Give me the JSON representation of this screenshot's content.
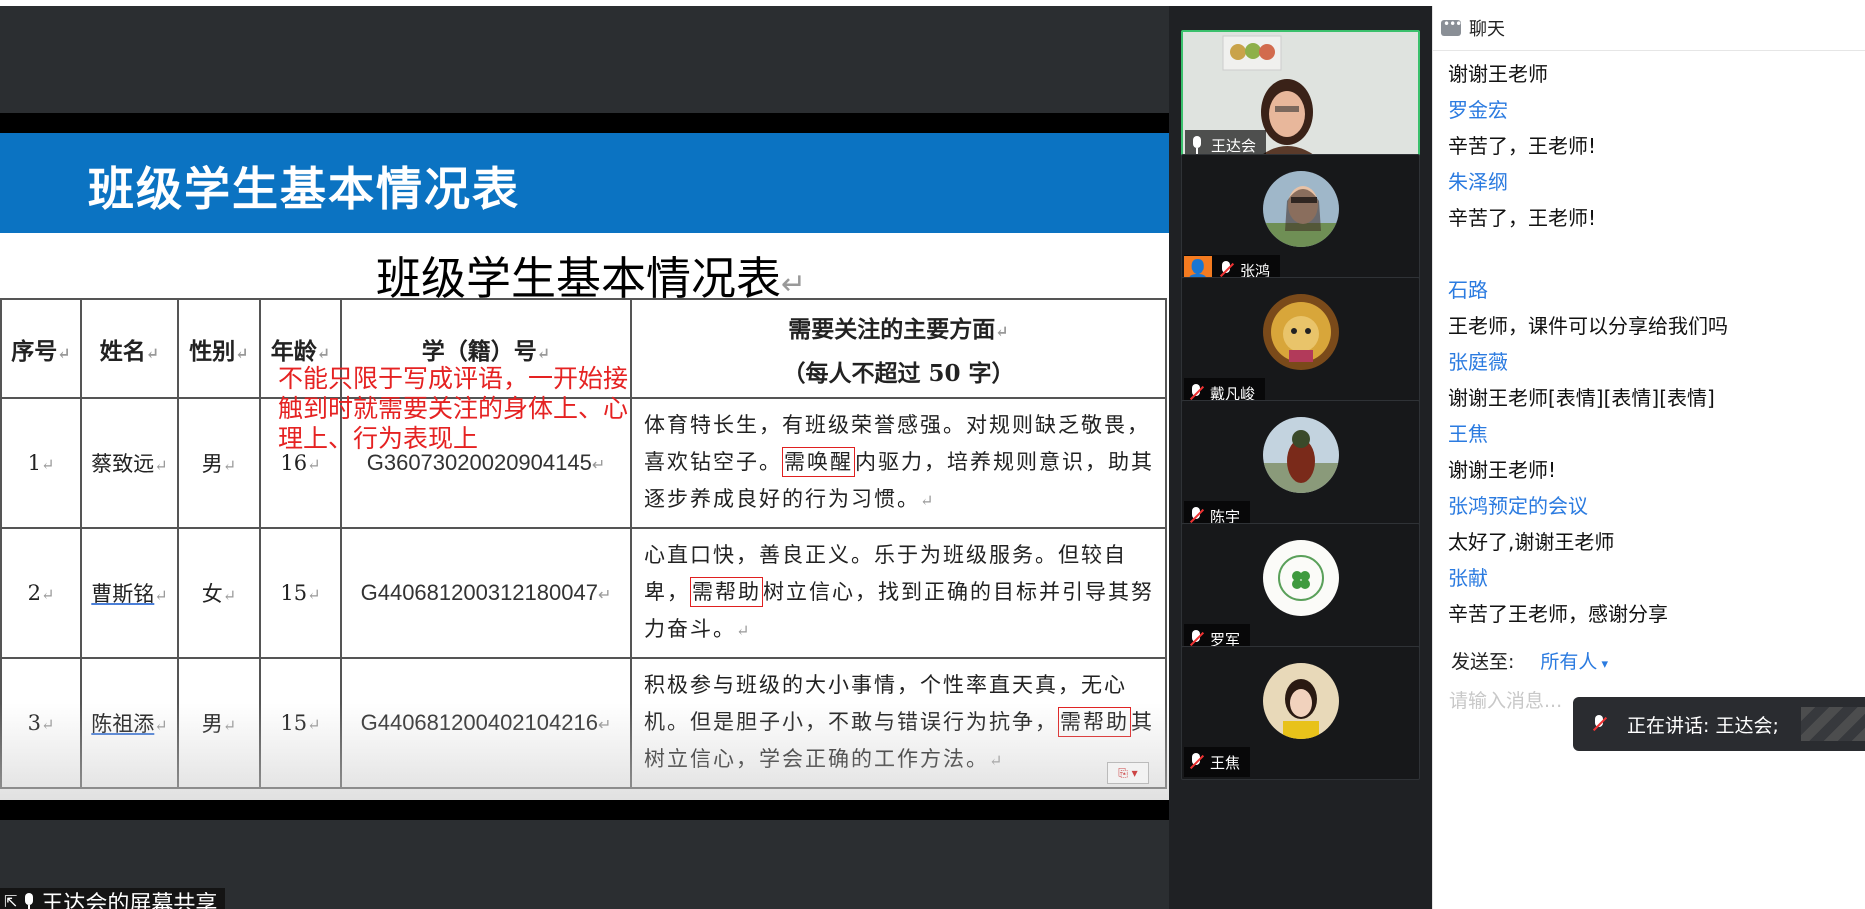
{
  "slide": {
    "header_title": "班级学生基本情况表",
    "doc_title": "班级学生基本情况表",
    "return_mark": "↵",
    "columns": [
      "序号",
      "姓名",
      "性别",
      "年龄",
      "学（籍）号",
      "需要关注的主要方面",
      "（每人不超过 50 字）"
    ],
    "rows": [
      {
        "no": "1",
        "name": "蔡致远",
        "gender": "男",
        "age": "16",
        "sid": "G36073020020904145",
        "desc_pre": "体育特长生，有班级荣誉感强。对规则缺乏敬畏，喜欢钻空子。",
        "desc_hl": "需唤醒",
        "desc_post": "内驱力，培养规则意识，助其逐步养成良好的行为习惯。"
      },
      {
        "no": "2",
        "name": "曹斯铭",
        "gender": "女",
        "age": "15",
        "sid": "G440681200312180047",
        "desc_pre": "心直口快，善良正义。乐于为班级服务。但较自卑，",
        "desc_hl": "需帮助",
        "desc_post": "树立信心，找到正确的目标并引导其努力奋斗。"
      },
      {
        "no": "3",
        "name": "陈祖添",
        "gender": "男",
        "age": "15",
        "sid": "G440681200402104216",
        "desc_pre": "积极参与班级的大小事情，个性率直天真，无心机。但是胆子小，不敢与错误行为抗争，",
        "desc_hl": "需帮助",
        "desc_post": "其树立信心，学会正确的工作方法。"
      }
    ],
    "annotation": "不能只限于写成评语，一开始接触到时就需要关注的身体上、心理上、行为表现上"
  },
  "share_label": "王达会的屏幕共享",
  "participants": [
    {
      "name": "王达会",
      "mic": "on",
      "active": true
    },
    {
      "name": "张鸿",
      "mic": "off",
      "host": true
    },
    {
      "name": "戴凡峻",
      "mic": "off"
    },
    {
      "name": "陈宇",
      "mic": "off"
    },
    {
      "name": "罗军",
      "mic": "off"
    },
    {
      "name": "王焦",
      "mic": "off"
    }
  ],
  "chat": {
    "title": "聊天",
    "messages": [
      {
        "type": "msg",
        "text": "谢谢王老师"
      },
      {
        "type": "sender",
        "text": "罗金宏"
      },
      {
        "type": "msg",
        "text": "辛苦了，王老师!"
      },
      {
        "type": "sender",
        "text": "朱泽纲"
      },
      {
        "type": "msg",
        "text": "辛苦了，王老师!"
      },
      {
        "type": "gap",
        "text": ""
      },
      {
        "type": "sender",
        "text": "石路"
      },
      {
        "type": "msg",
        "text": "王老师，课件可以分享给我们吗"
      },
      {
        "type": "sender",
        "text": "张庭薇"
      },
      {
        "type": "msg",
        "text": "谢谢王老师[表情][表情][表情]"
      },
      {
        "type": "sender",
        "text": "王焦"
      },
      {
        "type": "msg",
        "text": "谢谢王老师!"
      },
      {
        "type": "sender",
        "text": "张鸿预定的会议"
      },
      {
        "type": "msg",
        "text": "太好了,谢谢王老师"
      },
      {
        "type": "sender",
        "text": "张献"
      },
      {
        "type": "msg",
        "text": "辛苦了王老师，感谢分享"
      }
    ],
    "send_to_label": "发送至:",
    "send_to_target": "所有人",
    "input_placeholder": "请输入消息..."
  },
  "speaking": "正在讲话: 王达会;"
}
